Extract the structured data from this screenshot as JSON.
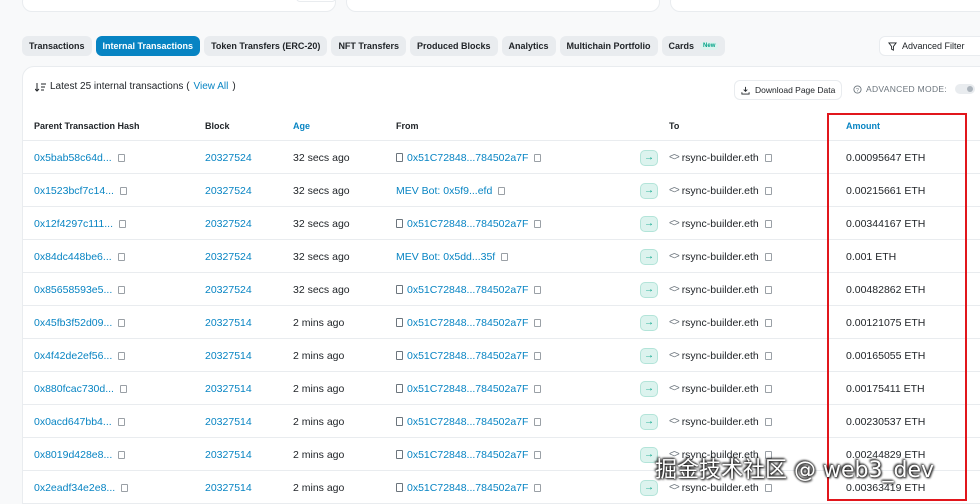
{
  "tabs": [
    {
      "label": "Transactions"
    },
    {
      "label": "Internal Transactions",
      "active": true
    },
    {
      "label": "Token Transfers (ERC-20)"
    },
    {
      "label": "NFT Transfers"
    },
    {
      "label": "Produced Blocks"
    },
    {
      "label": "Analytics"
    },
    {
      "label": "Multichain Portfolio"
    },
    {
      "label": "Cards",
      "badge": "New"
    }
  ],
  "advanced_filter": {
    "label": "Advanced Filter",
    "icon": "filter-icon"
  },
  "card": {
    "heading_prefix": "Latest 25 internal transactions (",
    "view_all": "View All",
    "heading_suffix": ")",
    "download_label": "Download Page Data",
    "advanced_mode_label": "ADVANCED MODE:"
  },
  "columns": {
    "parent_hash": "Parent Transaction Hash",
    "block": "Block",
    "age": "Age",
    "from": "From",
    "to": "To",
    "amount": "Amount"
  },
  "rows": [
    {
      "hash": "0x5bab58c64d...",
      "block": "20327524",
      "age": "32 secs ago",
      "from": "0x51C72848...784502a7F",
      "to": "rsync-builder.eth",
      "amount": "0.00095647 ETH"
    },
    {
      "hash": "0x1523bcf7c14...",
      "block": "20327524",
      "age": "32 secs ago",
      "from": "MEV Bot: 0x5f9...efd",
      "to": "rsync-builder.eth",
      "amount": "0.00215661 ETH"
    },
    {
      "hash": "0x12f4297c111...",
      "block": "20327524",
      "age": "32 secs ago",
      "from": "0x51C72848...784502a7F",
      "to": "rsync-builder.eth",
      "amount": "0.00344167 ETH"
    },
    {
      "hash": "0x84dc448be6...",
      "block": "20327524",
      "age": "32 secs ago",
      "from": "MEV Bot: 0x5dd...35f",
      "to": "rsync-builder.eth",
      "amount": "0.001 ETH"
    },
    {
      "hash": "0x85658593e5...",
      "block": "20327524",
      "age": "32 secs ago",
      "from": "0x51C72848...784502a7F",
      "to": "rsync-builder.eth",
      "amount": "0.00482862 ETH"
    },
    {
      "hash": "0x45fb3f52d09...",
      "block": "20327514",
      "age": "2 mins ago",
      "from": "0x51C72848...784502a7F",
      "to": "rsync-builder.eth",
      "amount": "0.00121075 ETH"
    },
    {
      "hash": "0x4f42de2ef56...",
      "block": "20327514",
      "age": "2 mins ago",
      "from": "0x51C72848...784502a7F",
      "to": "rsync-builder.eth",
      "amount": "0.00165055 ETH"
    },
    {
      "hash": "0x880fcac730d...",
      "block": "20327514",
      "age": "2 mins ago",
      "from": "0x51C72848...784502a7F",
      "to": "rsync-builder.eth",
      "amount": "0.00175411 ETH"
    },
    {
      "hash": "0x0acd647bb4...",
      "block": "20327514",
      "age": "2 mins ago",
      "from": "0x51C72848...784502a7F",
      "to": "rsync-builder.eth",
      "amount": "0.00230537 ETH"
    },
    {
      "hash": "0x8019d428e8...",
      "block": "20327514",
      "age": "2 mins ago",
      "from": "0x51C72848...784502a7F",
      "to": "rsync-builder.eth",
      "amount": "0.00244829 ETH"
    },
    {
      "hash": "0x2eadf34e2e8...",
      "block": "20327514",
      "age": "2 mins ago",
      "from": "0x51C72848...784502a7F",
      "to": "rsync-builder.eth",
      "amount": "0.00363419 ETH"
    }
  ],
  "watermark": "掘金技术社区 @ web3_dev",
  "colors": {
    "accent": "#0784c3",
    "highlight": "#e1161c",
    "success": "#00a186"
  }
}
